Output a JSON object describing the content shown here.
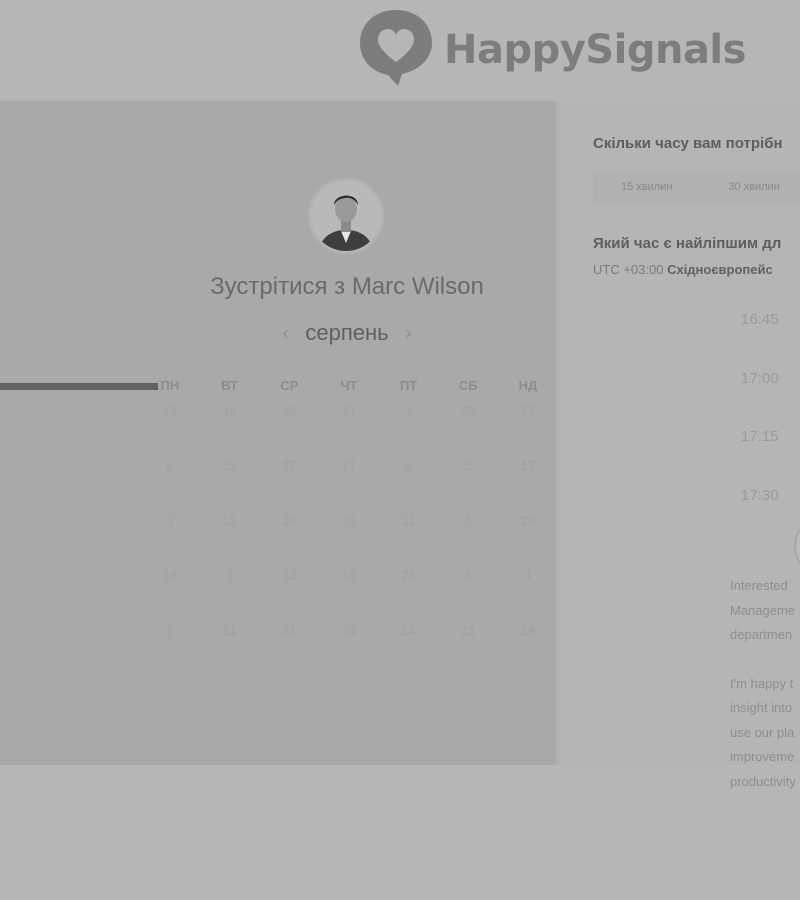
{
  "brand": {
    "name": "HappySignals",
    "logo_icon": "heart-speech-bubble-icon",
    "color": "#7d7d7d"
  },
  "host": {
    "title_prefix": "Зустрітися з",
    "name": "Marc Wilson",
    "avatar_icon": "person-avatar"
  },
  "calendar": {
    "month": "серпень",
    "prev_icon": "chevron-left-icon",
    "next_icon": "chevron-right-icon",
    "weekdays": [
      "ПН",
      "ВТ",
      "СР",
      "ЧТ",
      "ПТ",
      "СБ",
      "НД"
    ],
    "weeks": [
      [
        "12",
        "14",
        "16",
        "31",
        "3",
        "23",
        "22"
      ],
      [
        "6",
        "29",
        "27",
        "17",
        "9",
        "5",
        "17"
      ],
      [
        "3",
        "15",
        "26",
        "25",
        "11",
        "5",
        "28"
      ],
      [
        "14",
        "1",
        "13",
        "16",
        "23",
        "3",
        "4"
      ],
      [
        "2",
        "21",
        "31",
        "24",
        "14",
        "21",
        "28"
      ]
    ]
  },
  "duration": {
    "question": "Скільки часу вам потрібн",
    "options": [
      "15 хвилин",
      "30 хвилин"
    ]
  },
  "time": {
    "question": "Який час є найліпшим дл",
    "timezone_offset": "UTC +03:00",
    "timezone_name": "Східноєвропейс",
    "slots": [
      "16:45",
      "17:00",
      "17:15",
      "17:30"
    ]
  },
  "bio": {
    "paragraph1": [
      "Interested",
      "Manageme",
      "departmen"
    ],
    "paragraph2": [
      "I'm happy t",
      "insight into",
      "use our pla",
      "improveme",
      "productivity"
    ]
  }
}
